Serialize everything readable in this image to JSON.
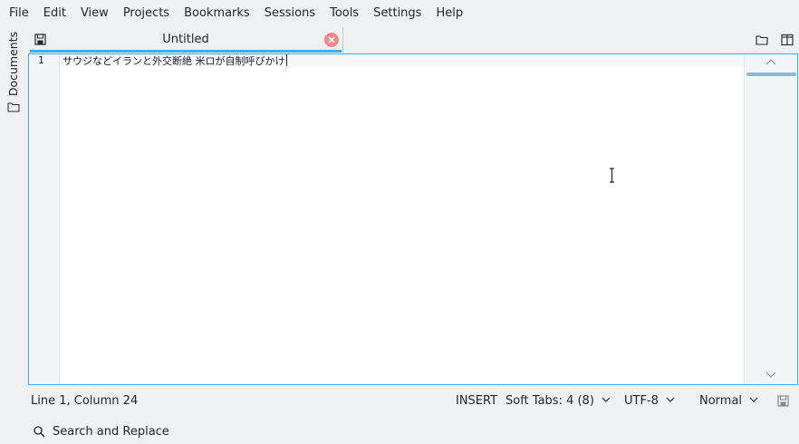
{
  "menu": [
    "File",
    "Edit",
    "View",
    "Projects",
    "Bookmarks",
    "Sessions",
    "Tools",
    "Settings",
    "Help"
  ],
  "side_panel": {
    "documents_label": "Documents"
  },
  "tab": {
    "title": "Untitled"
  },
  "editor": {
    "line_number": "1",
    "line_text": "サウジなどイランと外交断絶 米ロが自制呼びかけ"
  },
  "status": {
    "position": "Line 1, Column 24",
    "mode": "INSERT",
    "indentation": "Soft Tabs: 4 (8)",
    "encoding": "UTF-8",
    "highlighting": "Normal"
  },
  "search": {
    "label": "Search and Replace"
  },
  "colors": {
    "accent": "#3daee9",
    "close": "#f08a8a",
    "background": "#eff0f1"
  },
  "icons": [
    "save-icon",
    "close-icon",
    "folder-icon",
    "split-view-icon",
    "search-icon",
    "chevron-down-icon"
  ]
}
